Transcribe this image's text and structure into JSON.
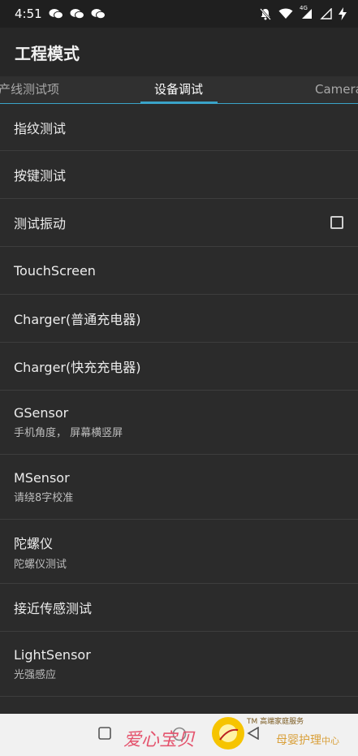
{
  "statusbar": {
    "time": "4:51",
    "network_badge": "4G"
  },
  "appbar": {
    "title": "工程模式"
  },
  "tabs": [
    {
      "label": "产线测试项"
    },
    {
      "label": "设备调试"
    },
    {
      "label": "Camera"
    }
  ],
  "items": [
    {
      "label": "指纹测试"
    },
    {
      "label": "按键测试"
    },
    {
      "label": "测试振动"
    },
    {
      "label": "TouchScreen"
    },
    {
      "label": "Charger(普通充电器)"
    },
    {
      "label": "Charger(快充充电器)"
    },
    {
      "label": "GSensor",
      "sub": "手机角度， 屏幕横竖屏"
    },
    {
      "label": "MSensor",
      "sub": "请绕8字校准"
    },
    {
      "label": "陀螺仪",
      "sub": "陀螺仪测试"
    },
    {
      "label": "接近传感测试"
    },
    {
      "label": "LightSensor",
      "sub": "光强感应"
    }
  ],
  "watermark": {
    "main": "爱心宝贝",
    "tm_line": "TM 高端家庭服务",
    "sub": "母婴护理",
    "sub_small": "中心"
  },
  "colors": {
    "accent": "#3aa3c8",
    "background": "#2b2b2b"
  }
}
